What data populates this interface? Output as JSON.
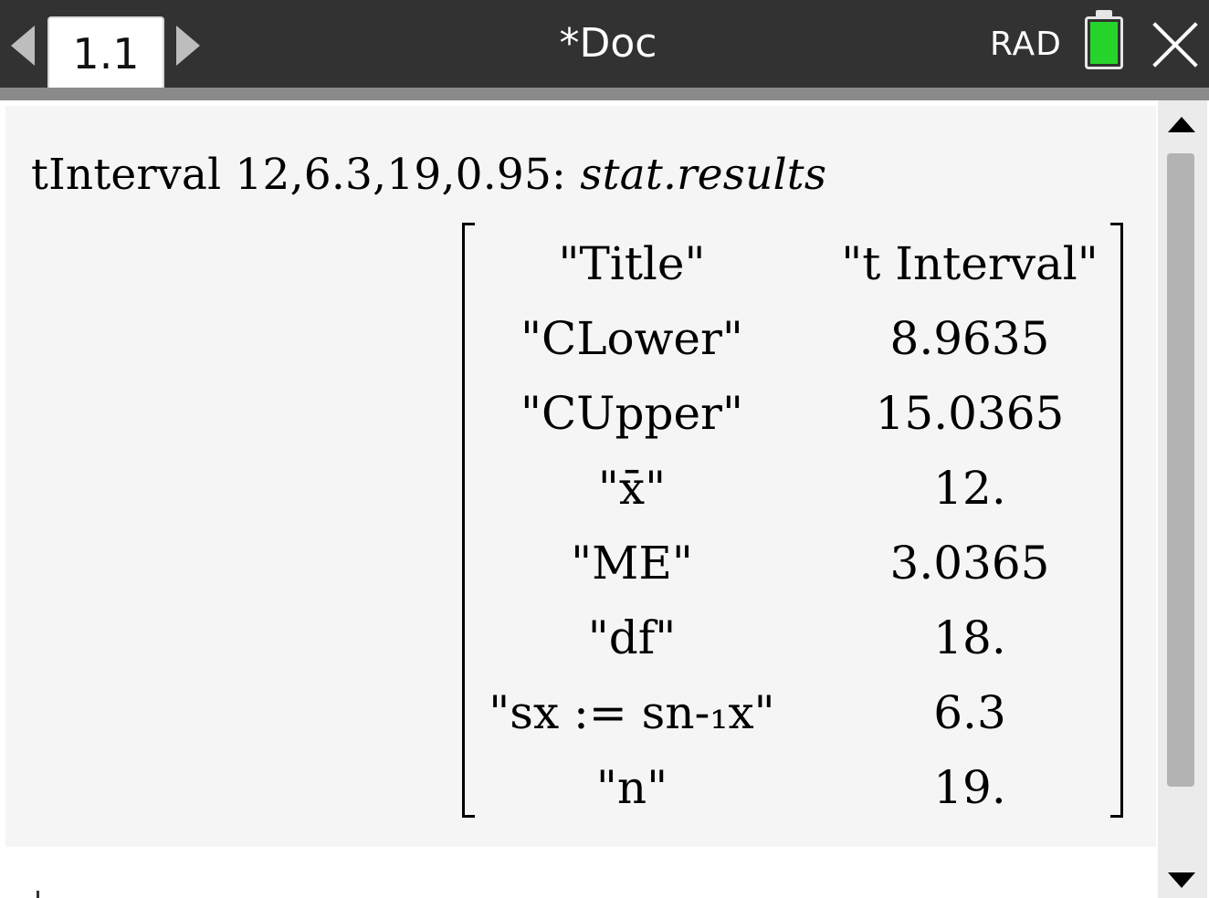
{
  "header": {
    "tab_label": "1.1",
    "doc_title": "*Doc",
    "angle_mode": "RAD",
    "battery_color": "#27d42b"
  },
  "entry": {
    "command": "tInterval 12,6.3,19,0.95:",
    "command_suffix": "stat.results"
  },
  "results": [
    {
      "name": "\"Title\"",
      "value": "\"t Interval\""
    },
    {
      "name": "\"CLower\"",
      "value": "8.9635"
    },
    {
      "name": "\"CUpper\"",
      "value": "15.0365"
    },
    {
      "name": "\"x̄\"",
      "value": "12."
    },
    {
      "name": "\"ME\"",
      "value": "3.0365"
    },
    {
      "name": "\"df\"",
      "value": "18."
    },
    {
      "name": "\"sx := sn-₁x\"",
      "value": "6.3"
    },
    {
      "name": "\"n\"",
      "value": "19."
    }
  ]
}
